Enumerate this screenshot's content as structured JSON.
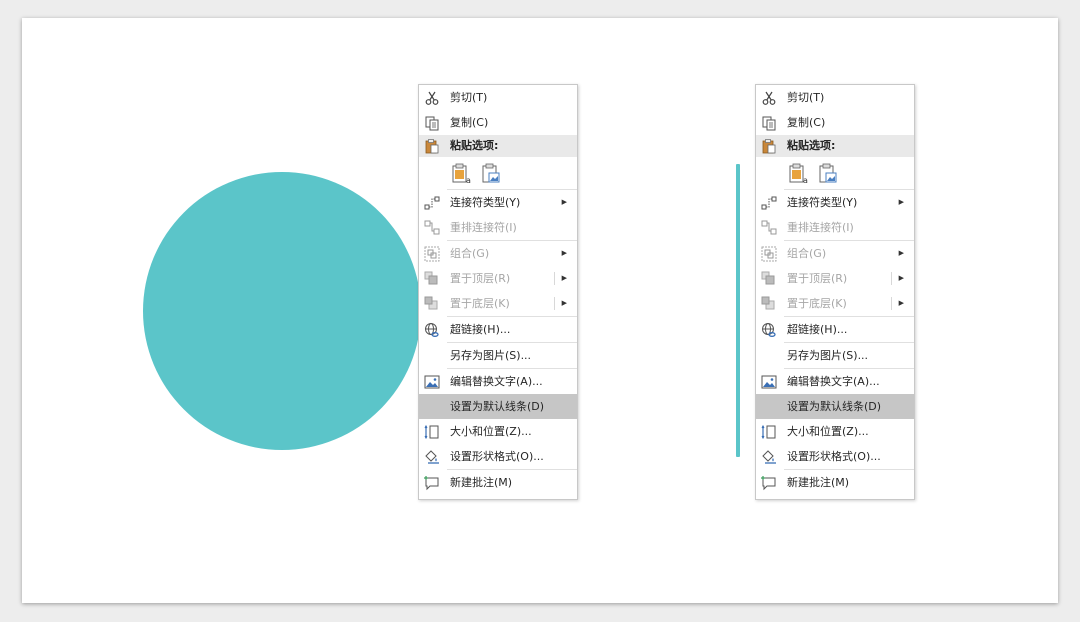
{
  "colors": {
    "shape_fill": "#5bc5c9",
    "menu_hover": "#c6c6c6",
    "menu_header_bg": "#e9e9e9",
    "disabled_text": "#a6a6a6"
  },
  "menus": {
    "left": {
      "cut": "剪切(T)",
      "copy": "复制(C)",
      "paste_header": "粘贴选项:",
      "connector_type": "连接符类型(Y)",
      "reroute": "重排连接符(I)",
      "group": "组合(G)",
      "bring_front": "置于顶层(R)",
      "send_back": "置于底层(K)",
      "hyperlink": "超链接(H)...",
      "save_as_picture": "另存为图片(S)...",
      "edit_alt_text": "编辑替换文字(A)...",
      "set_default_line": "设置为默认线条(D)",
      "size_position": "大小和位置(Z)...",
      "format_shape": "设置形状格式(O)...",
      "new_comment": "新建批注(M)"
    },
    "right": {
      "cut": "剪切(T)",
      "copy": "复制(C)",
      "paste_header": "粘贴选项:",
      "connector_type": "连接符类型(Y)",
      "reroute": "重排连接符(I)",
      "group": "组合(G)",
      "bring_front": "置于顶层(R)",
      "send_back": "置于底层(K)",
      "hyperlink": "超链接(H)...",
      "save_as_picture": "另存为图片(S)...",
      "edit_alt_text": "编辑替换文字(A)...",
      "set_default_line": "设置为默认线条(D)",
      "size_position": "大小和位置(Z)...",
      "format_shape": "设置形状格式(O)...",
      "new_comment": "新建批注(M)"
    }
  },
  "icons": {
    "cut": "scissors-icon",
    "copy": "copy-icon",
    "paste": "clipboard-icon",
    "paste_keep_text": "paste-keep-text-icon",
    "paste_picture": "paste-picture-icon",
    "connector": "connector-icon",
    "reroute": "reroute-icon",
    "group": "group-icon",
    "bring_front": "bring-front-icon",
    "send_back": "send-back-icon",
    "hyperlink": "globe-link-icon",
    "alt_text": "picture-icon",
    "size_position": "size-position-icon",
    "format_shape": "paint-bucket-icon",
    "comment": "comment-icon",
    "submenu": "submenu-arrow-icon"
  }
}
